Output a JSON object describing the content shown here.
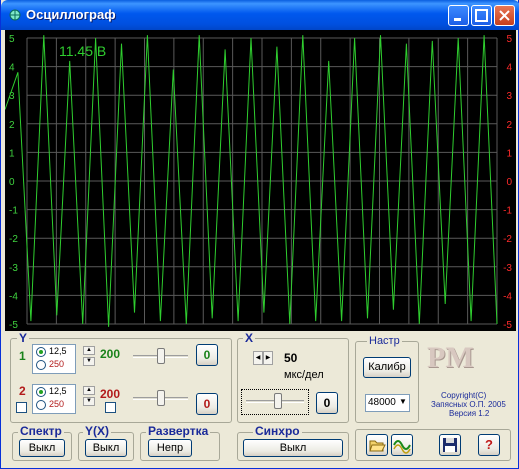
{
  "window": {
    "title": "Осциллограф"
  },
  "scope": {
    "readout": "11.45 В",
    "left_ticks": [
      "5",
      "4",
      "3",
      "2",
      "1",
      "0",
      "-1",
      "-2",
      "-3",
      "-4",
      "-5"
    ],
    "right_ticks": [
      "5",
      "4",
      "3",
      "2",
      "1",
      "0",
      "-1",
      "-2",
      "-3",
      "-4",
      "-5"
    ],
    "trace_color": "#2fce2f",
    "left_tick_color": "#3fd23f",
    "right_tick_color": "#ff2a2a"
  },
  "chart_data": {
    "type": "line",
    "ylim": [
      -5,
      5
    ],
    "series": [
      {
        "values": [
          2.5,
          3.8,
          -4.9,
          5.1,
          -4.7,
          4.2,
          -5.0,
          5.0,
          -5.1,
          4.8,
          -4.6,
          5.1,
          -4.9,
          3.9,
          -5.0,
          5.1,
          -4.8,
          4.6,
          -4.9,
          5.0,
          -4.6,
          4.7,
          -5.0,
          5.1,
          -4.9,
          4.2,
          -4.9,
          5.0,
          -4.8,
          5.1,
          -4.5,
          4.8,
          -5.0,
          4.9,
          -4.3,
          5.0,
          -4.9,
          5.1,
          -5.0
        ]
      }
    ]
  },
  "y_panel": {
    "label": "Y",
    "ch1": {
      "number": "1",
      "opt1": "12,5",
      "opt2": "250",
      "value": "200",
      "offset": "0",
      "color": "#19821a"
    },
    "ch2": {
      "number": "2",
      "opt1": "12,5",
      "opt2": "250",
      "value": "200",
      "offset": "0",
      "color": "#b21a1a"
    }
  },
  "x_panel": {
    "label": "X",
    "value": "50",
    "unit": "мкс/дел",
    "offset": "0"
  },
  "settings": {
    "label": "Настр",
    "calib_button": "Калибр",
    "rate": "48000"
  },
  "logo": {
    "text": "PM",
    "copyright": "Copyright(C)",
    "author": "Запясных О.П. 2005",
    "version": "Версия 1.2"
  },
  "spectrum": {
    "label": "Спектр",
    "button": "Выкл"
  },
  "yx": {
    "label": "Y(X)",
    "button": "Выкл"
  },
  "sweep": {
    "label": "Развертка",
    "button": "Непр"
  },
  "sync": {
    "label": "Синхро",
    "button": "Выкл"
  }
}
